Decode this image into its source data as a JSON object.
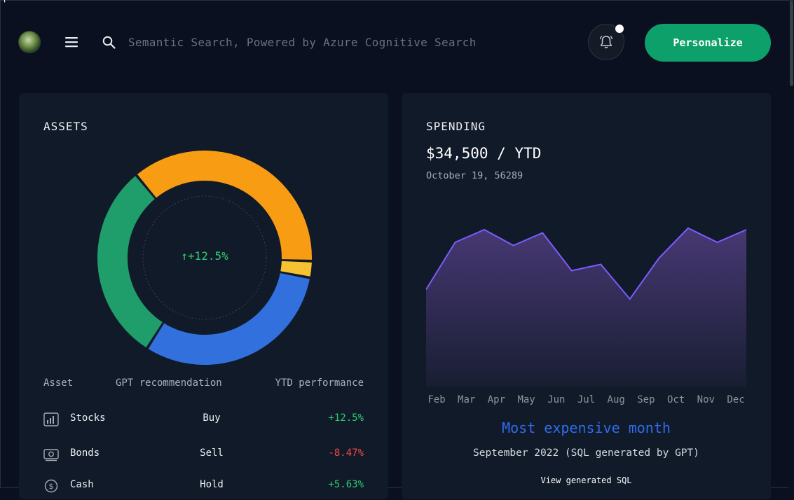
{
  "corner_mark": "'",
  "header": {
    "search_placeholder": "Semantic Search, Powered by Azure Cognitive Search",
    "personalize_label": "Personalize",
    "icons": [
      "avatar",
      "menu-icon",
      "search-icon",
      "bell-icon"
    ]
  },
  "assets": {
    "title": "ASSETS",
    "center_value": "+12.5%",
    "center_arrow": "↑",
    "colors": {
      "stocks": "#f59e0b",
      "yellow": "#f6c232",
      "bonds": "#3270dd",
      "cash": "#1f9d6b"
    },
    "segments": [
      {
        "name": "orange",
        "value": 36.5,
        "color": "#f89d13"
      },
      {
        "name": "yellow",
        "value": 2.5,
        "color": "#f6c232"
      },
      {
        "name": "blue",
        "value": 31,
        "color": "#3270dd"
      },
      {
        "name": "green",
        "value": 30,
        "color": "#1f9d6b"
      }
    ],
    "table": {
      "headers": {
        "asset": "Asset",
        "recommendation": "GPT recommendation",
        "performance": "YTD performance"
      },
      "rows": [
        {
          "name": "Stocks",
          "recommendation": "Buy",
          "performance": "+12.5%",
          "icon": "chart-icon",
          "color": "#2ecc71"
        },
        {
          "name": "Bonds",
          "recommendation": "Sell",
          "performance": "-8.47%",
          "icon": "cash-note-icon",
          "color": "#f04848"
        },
        {
          "name": "Cash",
          "recommendation": "Hold",
          "performance": "+5.63%",
          "icon": "dollar-coin-icon",
          "color": "#2ecc71"
        }
      ]
    }
  },
  "spending": {
    "title": "SPENDING",
    "amount": "$34,500 / YTD",
    "date": "October 19, 56289",
    "most_expensive_title": "Most expensive month",
    "most_expensive_detail": "September 2022 (SQL generated by GPT)",
    "view_sql": "View generated SQL",
    "chart_data": {
      "type": "area",
      "categories": [
        "Feb",
        "Mar",
        "Apr",
        "May",
        "Jun",
        "Jul",
        "Aug",
        "Sep",
        "Oct",
        "Nov",
        "Dec"
      ],
      "series": [
        {
          "values": [
            62,
            92,
            100,
            90,
            98,
            74,
            78,
            56,
            82,
            101,
            92,
            100
          ]
        }
      ],
      "ylim": [
        0,
        120
      ],
      "line_color": "#7a5cff",
      "fill_color": "#4a3a78"
    }
  }
}
